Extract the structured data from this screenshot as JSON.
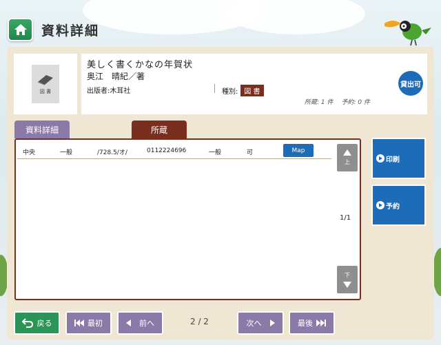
{
  "header": {
    "title": "資料詳細",
    "home_icon": "home-icon"
  },
  "book": {
    "thumbnail_label": "図 書",
    "title": "美しく書くかなの年賀状",
    "author": "奥江　晴紀／著",
    "publisher": "出版者:木耳社",
    "type_label": "種別:",
    "type_value": "図 書",
    "holdings": "所蔵: 1 件　 予約: 0 件",
    "lend_status": "貸出可"
  },
  "tabs": {
    "detail": "資料詳細",
    "holding": "所蔵"
  },
  "holding_row": {
    "location": "中央",
    "category": "一般",
    "call_number": "/728.5/オ/",
    "material_id": "0112224696",
    "shelf": "一般",
    "status": "可",
    "map_label": "Map"
  },
  "list": {
    "scroll_up_label": "上",
    "scroll_down_label": "下",
    "page": "1/1"
  },
  "side": {
    "print": "印刷",
    "reserve": "予約"
  },
  "nav": {
    "back": "戻る",
    "first": "最初",
    "prev": "前へ",
    "page": "2 / 2",
    "next": "次へ",
    "last": "最後"
  },
  "colors": {
    "accent_blue": "#1d6cb8",
    "tab_brown": "#7a2e1e",
    "nav_purple": "#8b7aa8",
    "home_green": "#2d9457"
  }
}
